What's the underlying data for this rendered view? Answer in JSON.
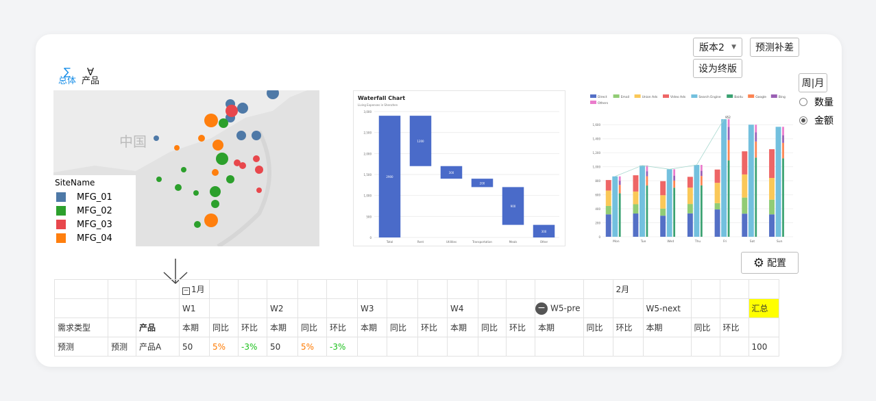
{
  "toolbar": {
    "version_select": "版本2",
    "forecast_adjust": "预测补差",
    "set_final": "设为终版",
    "period_toggle": "周|月",
    "config_button": "配置"
  },
  "modes": {
    "total": "总体",
    "product": "产品"
  },
  "radio": {
    "quantity": "数量",
    "amount": "金额",
    "selected": "金额"
  },
  "map": {
    "china_label": "中国",
    "legend_title": "SiteName",
    "legend": [
      {
        "label": "MFG_01",
        "color": "#4e79a7"
      },
      {
        "label": "MFG_02",
        "color": "#2ca02c"
      },
      {
        "label": "MFG_03",
        "color": "#e8474c"
      },
      {
        "label": "MFG_04",
        "color": "#ff7f0e"
      }
    ]
  },
  "chart_data": [
    {
      "type": "bar",
      "title": "Waterfall Chart",
      "subtitle": "Living Expenses in Shenzhen",
      "categories": [
        "Total",
        "Rent",
        "Utilities",
        "Transportation",
        "Meals",
        "Other"
      ],
      "values": [
        2900,
        1200,
        300,
        200,
        900,
        300
      ],
      "bases": [
        0,
        1700,
        1400,
        1200,
        300,
        0
      ],
      "ylim": [
        0,
        3000
      ],
      "yticks": [
        0,
        500,
        1000,
        1500,
        2000,
        2500,
        3000
      ]
    },
    {
      "type": "bar",
      "categories": [
        "Mon",
        "Tue",
        "Wed",
        "Thu",
        "Fri",
        "Sat",
        "Sun"
      ],
      "ylim": [
        0,
        1700
      ],
      "yticks": [
        0,
        200,
        400,
        600,
        800,
        1000,
        1200,
        1400,
        1600
      ],
      "series": [
        {
          "name": "Direct",
          "color": "#5470c6",
          "values": [
            320,
            332,
            301,
            334,
            390,
            330,
            320
          ]
        },
        {
          "name": "Email",
          "color": "#91cc75",
          "values": [
            120,
            132,
            101,
            134,
            90,
            230,
            210
          ]
        },
        {
          "name": "Union Ads",
          "color": "#fac858",
          "values": [
            220,
            182,
            191,
            234,
            290,
            330,
            310
          ]
        },
        {
          "name": "Video Ads",
          "color": "#ee6666",
          "values": [
            150,
            232,
            201,
            154,
            190,
            330,
            410
          ]
        },
        {
          "name": "Search Engine",
          "color": "#73c0de",
          "values": [
            862,
            1018,
            964,
            1026,
            1679,
            1600,
            1570
          ]
        },
        {
          "name": "Baidu",
          "color": "#3ba272",
          "values": [
            620,
            732,
            701,
            734,
            1090,
            1130,
            1120
          ]
        },
        {
          "name": "Google",
          "color": "#fc8452",
          "values": [
            120,
            132,
            101,
            134,
            290,
            230,
            220
          ]
        },
        {
          "name": "Bing",
          "color": "#9a60b4",
          "values": [
            60,
            72,
            71,
            74,
            190,
            130,
            110
          ]
        },
        {
          "name": "Others",
          "color": "#ea7ccc",
          "values": [
            62,
            82,
            91,
            84,
            109,
            110,
            120
          ]
        }
      ],
      "line_label": "952"
    }
  ],
  "table": {
    "month_row": [
      "",
      "",
      "",
      "1月",
      "",
      "",
      "",
      "",
      "",
      "",
      "",
      "",
      "",
      "",
      "",
      "",
      "",
      "2月",
      "",
      "",
      "",
      ""
    ],
    "week_row": [
      "",
      "",
      "",
      "W1",
      "",
      "",
      "W2",
      "",
      "",
      "W3",
      "",
      "",
      "W4",
      "",
      "",
      "W5-pre",
      "",
      "",
      "W5-next",
      "",
      "",
      "汇总"
    ],
    "header_row": [
      "需求类型",
      "",
      "产品",
      "本期",
      "同比",
      "环比",
      "本期",
      "同比",
      "环比",
      "本期",
      "同比",
      "环比",
      "本期",
      "同比",
      "环比",
      "本期",
      "同比",
      "环比",
      "本期",
      "同比",
      "环比",
      ""
    ],
    "data_row": [
      "预测",
      "预测",
      "产品A",
      "50",
      "5%",
      "-3%",
      "50",
      "5%",
      "-3%",
      "",
      "",
      "",
      "",
      "",
      "",
      "",
      "",
      "",
      "",
      "",
      "",
      "100"
    ]
  }
}
